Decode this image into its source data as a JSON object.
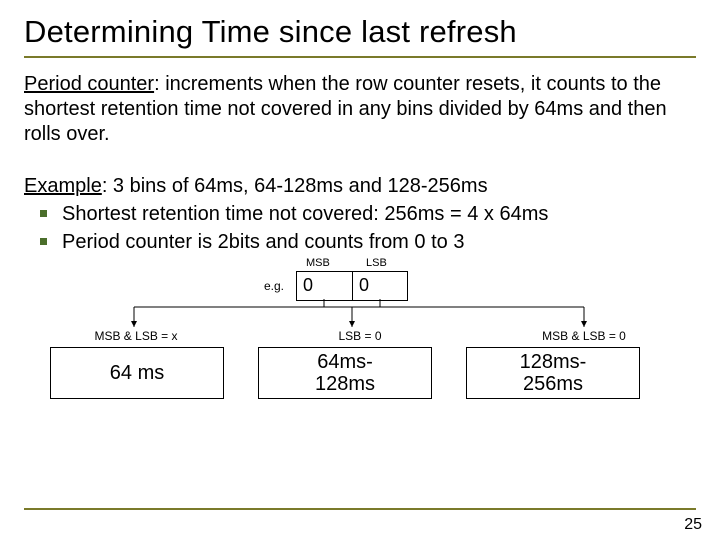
{
  "title": "Determining Time since last refresh",
  "period_counter": {
    "label": "Period counter",
    "text": ": increments when the row counter resets, it counts to the shortest retention time not covered in any bins divided by 64ms and then rolls over."
  },
  "example": {
    "label": "Example",
    "intro": ": 3 bins of 64ms, 64-128ms and 128-256ms",
    "bullets": [
      "Shortest retention time not covered: 256ms = 4 x 64ms",
      "Period counter is 2bits and counts from 0 to 3"
    ]
  },
  "diagram": {
    "msb": "MSB",
    "lsb": "LSB",
    "eg": "e.g.",
    "bit0": "0",
    "bit1": "0",
    "conditions": [
      "MSB & LSB = x",
      "LSB = 0",
      "MSB & LSB = 0"
    ],
    "bins": [
      "64 ms",
      "64ms-\n128ms",
      "128ms-\n256ms"
    ]
  },
  "page_number": "25"
}
